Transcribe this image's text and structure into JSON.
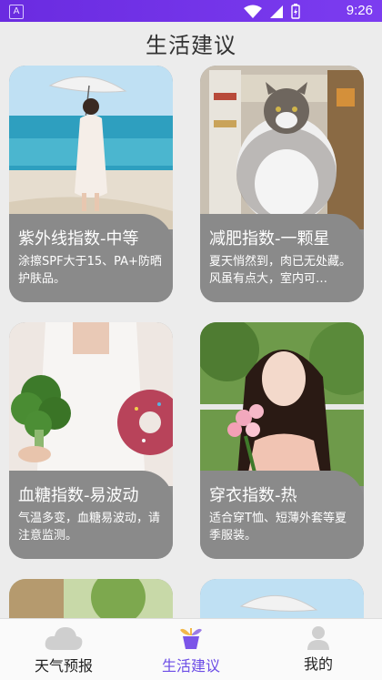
{
  "status_bar": {
    "time": "9:26",
    "left_icon": "A"
  },
  "page": {
    "title": "生活建议"
  },
  "cards": [
    {
      "title": "紫外线指数-中等",
      "desc": "涂擦SPF大于15、PA+防晒护肤品。",
      "image": "woman-umbrella-beach"
    },
    {
      "title": "减肥指数-一颗星",
      "desc": "夏天悄然到，肉已无处藏。风虽有点大，室内可…",
      "image": "fat-cat-fridge"
    },
    {
      "title": "血糖指数-易波动",
      "desc": "气温多变，血糖易波动，请注意监测。",
      "image": "broccoli-donut"
    },
    {
      "title": "穿衣指数-热",
      "desc": "适合穿T恤、短薄外套等夏季服装。",
      "image": "girl-with-flowers"
    }
  ],
  "bottom_nav": {
    "items": [
      {
        "label": "天气预报",
        "icon": "cloud-icon"
      },
      {
        "label": "生活建议",
        "icon": "plant-pot-icon"
      },
      {
        "label": "我的",
        "icon": "person-icon"
      }
    ],
    "active_index": 1
  },
  "colors": {
    "accent": "#6b4ce6",
    "status_bar": "#7030e8",
    "card_panel": "#8a8a8a"
  }
}
